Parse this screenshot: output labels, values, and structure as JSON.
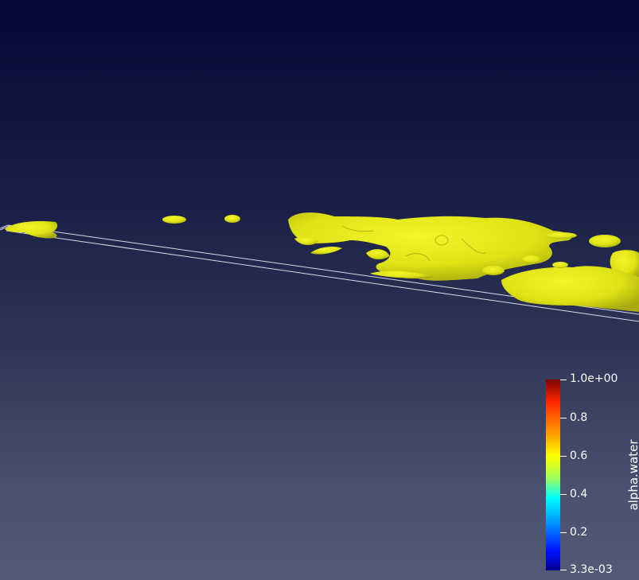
{
  "scalar_bar": {
    "title": "alpha.water",
    "labels": [
      "1.0e+00",
      "0.8",
      "0.6",
      "0.4",
      "0.2",
      "3.3e-03"
    ]
  },
  "colors": {
    "background_top": "#030935",
    "background_bottom": "#535a74",
    "isosurface": "#e8ea12",
    "outline": "#d8dbe6"
  }
}
